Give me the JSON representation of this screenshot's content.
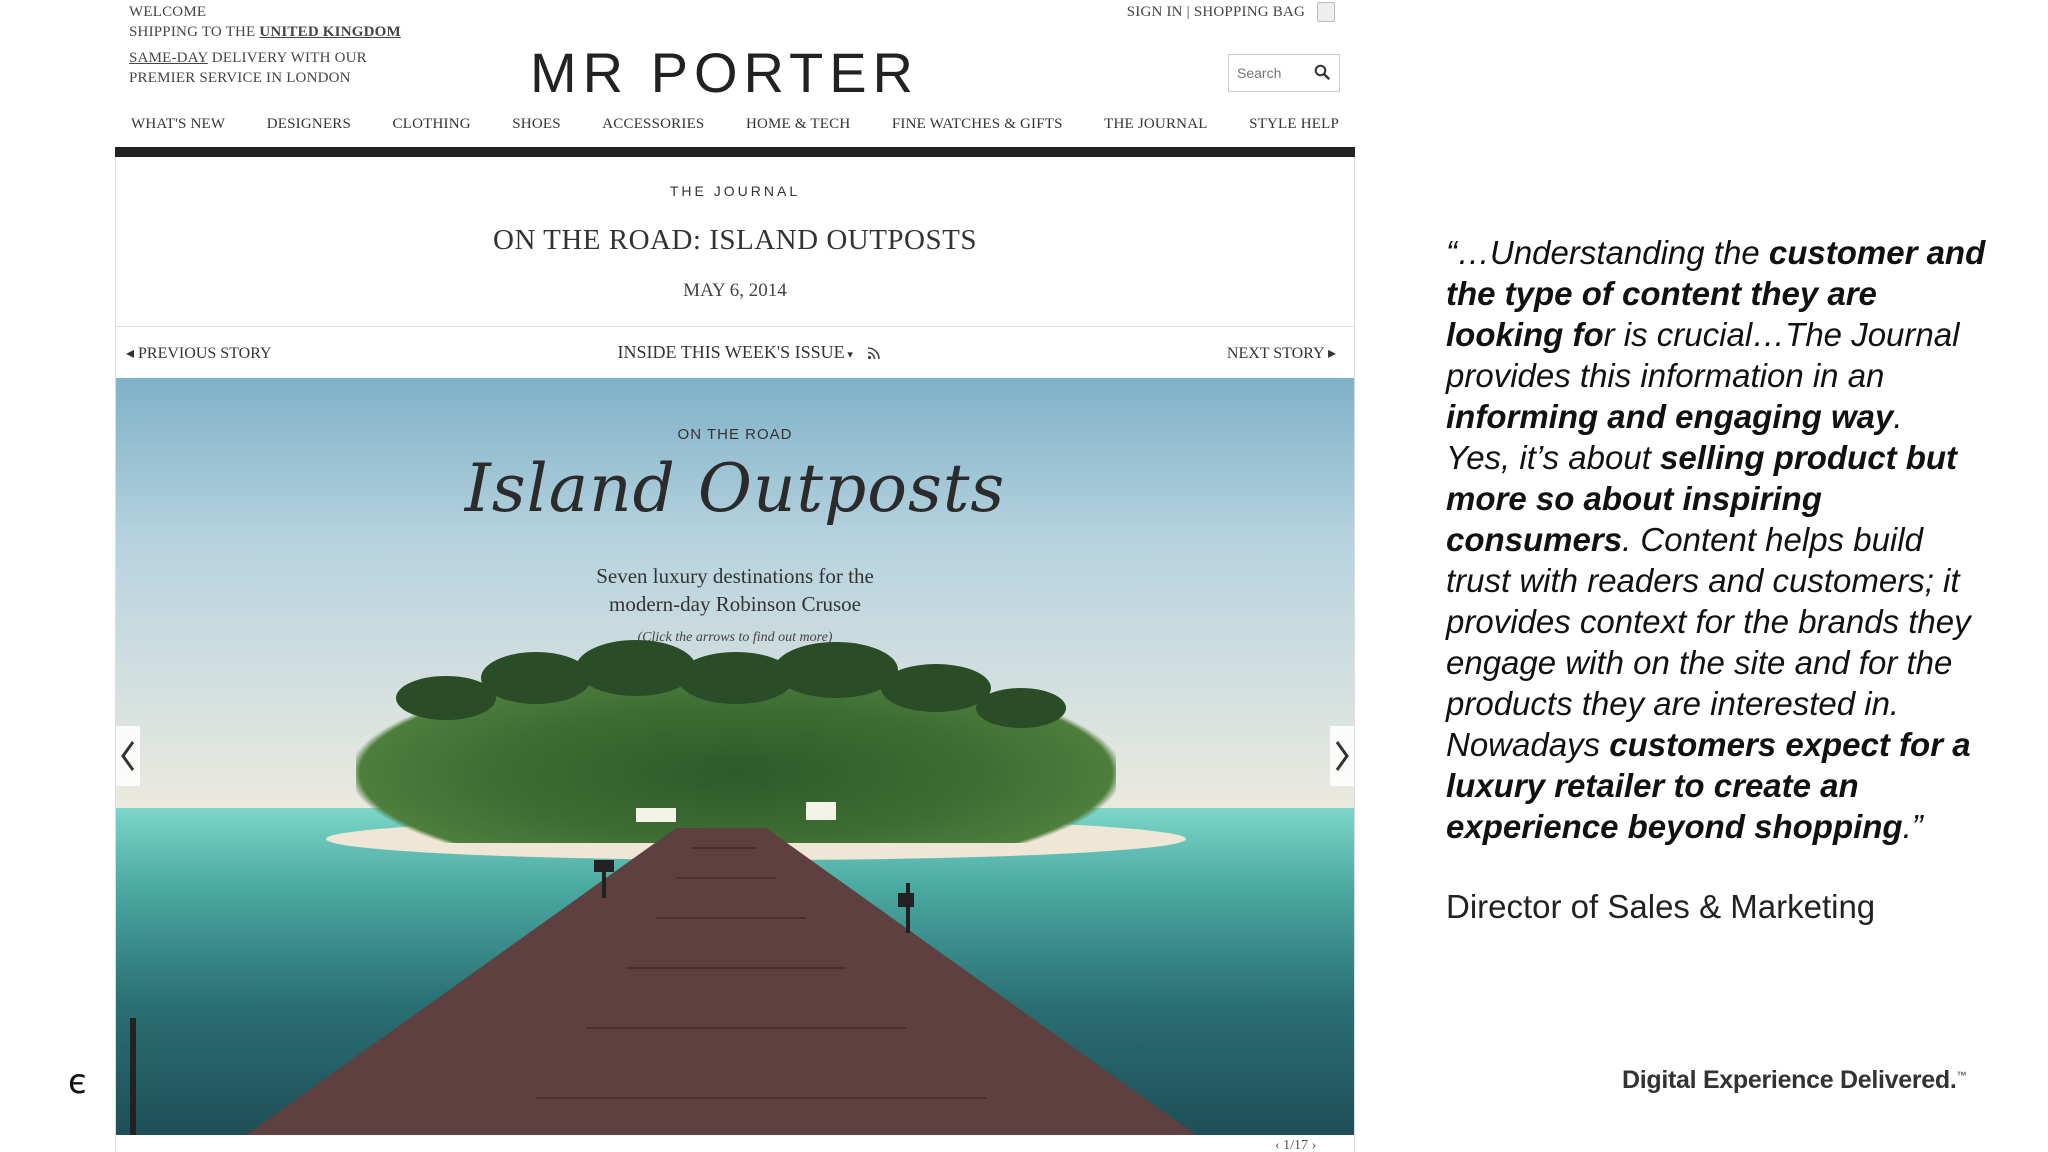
{
  "site": {
    "welcome": "WELCOME",
    "shipping_prefix": "SHIPPING TO THE ",
    "shipping_country": "UNITED KINGDOM",
    "sameday_link": "SAME-DAY",
    "sameday_rest": " DELIVERY WITH OUR",
    "premier": "PREMIER SERVICE IN LONDON",
    "signin": "SIGN IN | SHOPPING BAG",
    "logo": "MR PORTER",
    "search_placeholder": "Search",
    "nav": [
      "WHAT'S NEW",
      "DESIGNERS",
      "CLOTHING",
      "SHOES",
      "ACCESSORIES",
      "HOME & TECH",
      "FINE WATCHES & GIFTS",
      "THE JOURNAL",
      "STYLE HELP"
    ]
  },
  "story": {
    "kicker": "THE JOURNAL",
    "title": "ON THE ROAD: ISLAND OUTPOSTS",
    "date": "MAY 6, 2014",
    "previous": "PREVIOUS STORY",
    "inside": "INSIDE THIS WEEK'S ISSUE",
    "next": "NEXT STORY"
  },
  "hero": {
    "kicker": "ON THE ROAD",
    "script_title": "Island Outposts",
    "sub1": "Seven luxury destinations for the",
    "sub2": "modern-day Robinson Crusoe",
    "note": "(Click the arrows to find out more)",
    "pager": "1/17"
  },
  "quote": {
    "lines": [
      [
        {
          "t": "“…Understanding the ",
          "b": false
        },
        {
          "t": "customer and",
          "b": true
        }
      ],
      [
        {
          "t": "the type of content they are",
          "b": true
        }
      ],
      [
        {
          "t": "looking fo",
          "b": true
        },
        {
          "t": "r is crucial…The Journal",
          "b": false
        }
      ],
      [
        {
          "t": "provides this information in an",
          "b": false
        }
      ],
      [
        {
          "t": "informing and engaging way",
          "b": true
        },
        {
          "t": ".",
          "b": false
        }
      ],
      [
        {
          "t": "Yes, it’s about ",
          "b": false
        },
        {
          "t": "selling product but",
          "b": true
        }
      ],
      [
        {
          "t": "more so about inspiring",
          "b": true
        }
      ],
      [
        {
          "t": "consumers",
          "b": true
        },
        {
          "t": ". Content helps build",
          "b": false
        }
      ],
      [
        {
          "t": "trust with readers and customers; it",
          "b": false
        }
      ],
      [
        {
          "t": "provides context for the brands they",
          "b": false
        }
      ],
      [
        {
          "t": "engage with on the site and for the",
          "b": false
        }
      ],
      [
        {
          "t": "products they are interested in.",
          "b": false
        }
      ],
      [
        {
          "t": "Nowadays ",
          "b": false
        },
        {
          "t": "customers expect for a",
          "b": true
        }
      ],
      [
        {
          "t": "luxury retailer to create an",
          "b": true
        }
      ],
      [
        {
          "t": "experience beyond shopping",
          "b": true
        },
        {
          "t": ".”",
          "b": false
        }
      ]
    ],
    "attribution": "Director of Sales & Marketing"
  },
  "footer": {
    "mark": "є",
    "tagline": "Digital Experience Delivered.",
    "tm": "™"
  }
}
